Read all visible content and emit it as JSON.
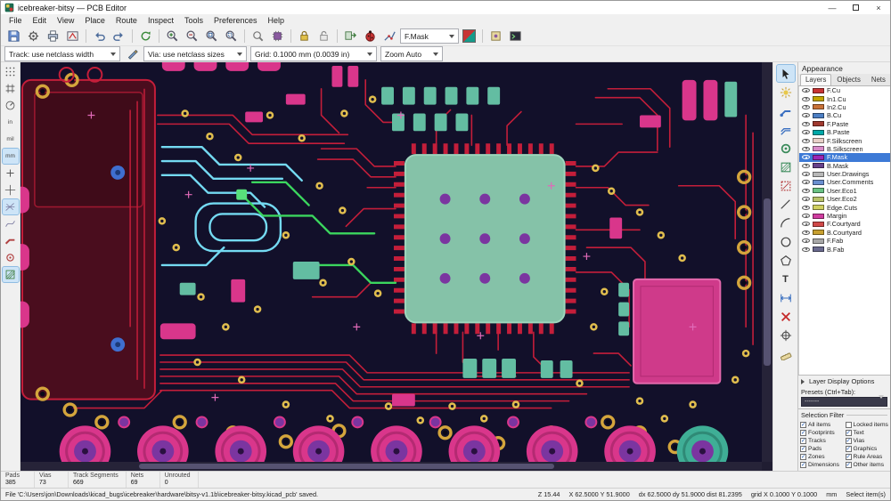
{
  "window": {
    "title": "icebreaker-bitsy — PCB Editor"
  },
  "menu": {
    "items": [
      "File",
      "Edit",
      "View",
      "Place",
      "Route",
      "Inspect",
      "Tools",
      "Preferences",
      "Help"
    ]
  },
  "toolbar": {
    "icons": [
      "save",
      "board-setup",
      "print",
      "plot",
      "undo",
      "redo",
      "refresh",
      "zoom-in",
      "zoom-out",
      "zoom-fit",
      "zoom-selection",
      "find",
      "footprint-editor",
      "lock",
      "unlock",
      "update-pcb",
      "drc",
      "net-inspector",
      "layer-pair",
      "footprint-wizard",
      "scripting-console"
    ],
    "layer_selector": {
      "value": "F.Mask"
    }
  },
  "toolbar2": {
    "track_width": "Track: use netclass width",
    "via_size": "Via: use netclass sizes",
    "grid": "Grid: 0.1000 mm (0.0039 in)",
    "zoom": "Zoom Auto"
  },
  "left_toolbar_icons": [
    "grid-dots",
    "grid-lines",
    "polar-coords",
    "units-inches",
    "units-mils",
    "units-mm",
    "cursor-shape",
    "cursor-fullscreen",
    "ratsnest-visibility",
    "ratsnest-curved",
    "track-outline-mode",
    "via-outline-mode",
    "zone-display-mode"
  ],
  "right_toolbar_icons": [
    "select-tool",
    "highlight-net",
    "route-track",
    "route-diff-pair",
    "place-via",
    "draw-zone",
    "rule-area",
    "graphic-line",
    "graphic-arc",
    "graphic-circle",
    "graphic-polygon",
    "text-tool",
    "dimension-tool",
    "delete-tool",
    "origin-tool",
    "measure-tool"
  ],
  "appearance": {
    "title": "Appearance",
    "tabs": [
      "Layers",
      "Objects",
      "Nets"
    ],
    "active_tab": "Layers",
    "selected_layer": "F.Mask",
    "layers": [
      {
        "name": "F.Cu",
        "color": "#C83434"
      },
      {
        "name": "In1.Cu",
        "color": "#C2A500"
      },
      {
        "name": "In2.Cu",
        "color": "#C87137"
      },
      {
        "name": "B.Cu",
        "color": "#4D7FC4"
      },
      {
        "name": "F.Paste",
        "color": "#A0392F"
      },
      {
        "name": "B.Paste",
        "color": "#00A8A8"
      },
      {
        "name": "F.Silkscreen",
        "color": "#E8D0C8"
      },
      {
        "name": "B.Silkscreen",
        "color": "#D88AC8"
      },
      {
        "name": "F.Mask",
        "color": "#9C26B5"
      },
      {
        "name": "B.Mask",
        "color": "#66418A"
      },
      {
        "name": "User.Drawings",
        "color": "#B8B8B8"
      },
      {
        "name": "User.Comments",
        "color": "#6A8FD0"
      },
      {
        "name": "User.Eco1",
        "color": "#6AC284"
      },
      {
        "name": "User.Eco2",
        "color": "#B8C26A"
      },
      {
        "name": "Edge.Cuts",
        "color": "#D0D060"
      },
      {
        "name": "Margin",
        "color": "#D03CA0"
      },
      {
        "name": "F.Courtyard",
        "color": "#D04848"
      },
      {
        "name": "B.Courtyard",
        "color": "#C8A030"
      },
      {
        "name": "F.Fab",
        "color": "#A8A8A8"
      },
      {
        "name": "B.Fab",
        "color": "#6A6A8E"
      }
    ],
    "layer_display_label": "Layer Display Options",
    "presets_label": "Presets (Ctrl+Tab):",
    "presets_value": "-------"
  },
  "selection_filter": {
    "title": "Selection Filter",
    "items": [
      {
        "label": "All items",
        "checked": true
      },
      {
        "label": "Locked items",
        "checked": false
      },
      {
        "label": "Footprints",
        "checked": true
      },
      {
        "label": "Text",
        "checked": true
      },
      {
        "label": "Tracks",
        "checked": true
      },
      {
        "label": "Vias",
        "checked": true
      },
      {
        "label": "Pads",
        "checked": true
      },
      {
        "label": "Graphics",
        "checked": true
      },
      {
        "label": "Zones",
        "checked": true
      },
      {
        "label": "Rule Areas",
        "checked": true
      },
      {
        "label": "Dimensions",
        "checked": true
      },
      {
        "label": "Other items",
        "checked": true
      }
    ]
  },
  "status": {
    "cols": [
      {
        "label": "Pads",
        "value": "385"
      },
      {
        "label": "Vias",
        "value": "73"
      },
      {
        "label": "Track Segments",
        "value": "669"
      },
      {
        "label": "Nets",
        "value": "69"
      },
      {
        "label": "Unrouted",
        "value": "0"
      }
    ]
  },
  "bottom": {
    "message": "File 'C:\\Users\\jon\\Downloads\\kicad_bugs\\icebreaker\\hardware\\bitsy-v1.1b\\icebreaker-bitsy.kicad_pcb' saved.",
    "zoom": "Z 15.44",
    "xy": "X 62.5000 Y 51.9000",
    "delta": "dx 62.5000  dy 51.9000  dist 81.2395",
    "grid": "grid X 0.1000  Y 0.1000",
    "units": "mm",
    "mode": "Select item(s)"
  },
  "board_colors": {
    "background": "#12102a",
    "copper_trace": "#c41e3a",
    "zone_fill": "#4a0d1e",
    "mask_pad_pink": "#d9368b",
    "paste_teal": "#63bda2",
    "mcu_body": "#85c2a8",
    "via_gold": "#e0bd4e",
    "hole_gold": "#d4a53c",
    "b_cu_cyan": "#74daf2",
    "highlight_green": "#3bd65e",
    "inner_purple": "#7b35a0"
  }
}
